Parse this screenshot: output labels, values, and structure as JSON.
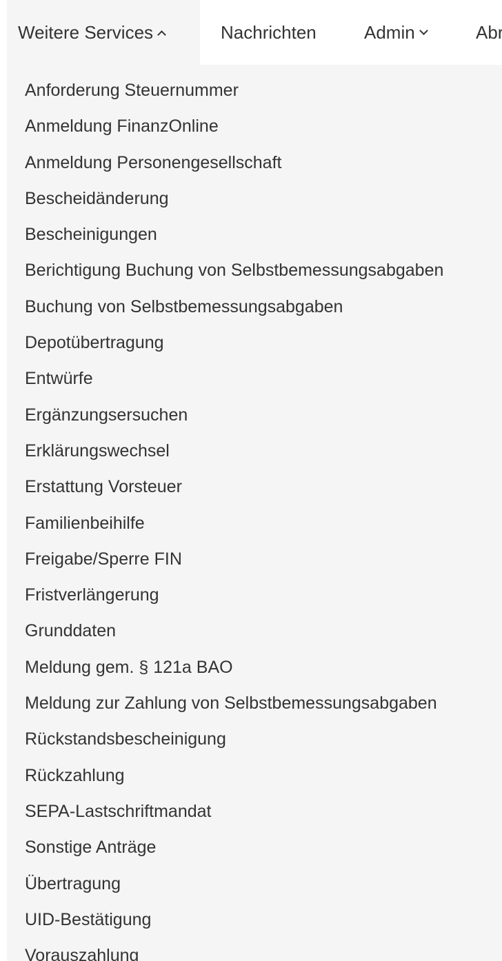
{
  "nav": {
    "items": [
      {
        "label": "Weitere Services"
      },
      {
        "label": "Nachrichten"
      },
      {
        "label": "Admin"
      },
      {
        "label": "Abr"
      }
    ]
  },
  "dropdown": {
    "items": [
      "Anforderung Steuernummer",
      "Anmeldung FinanzOnline",
      "Anmeldung Personengesellschaft",
      "Bescheidänderung",
      "Bescheinigungen",
      "Berichtigung Buchung von Selbstbemessungsabgaben",
      "Buchung von Selbstbemessungsabgaben",
      "Depotübertragung",
      "Entwürfe",
      "Ergänzungsersuchen",
      "Erklärungswechsel",
      "Erstattung Vorsteuer",
      "Familienbeihilfe",
      "Freigabe/Sperre FIN",
      "Fristverlängerung",
      "Grunddaten",
      "Meldung gem. § 121a BAO",
      "Meldung zur Zahlung von Selbstbemessungsabgaben",
      "Rückstandsbescheinigung",
      "Rückzahlung",
      "SEPA-Lastschriftmandat",
      "Sonstige Anträge",
      "Übertragung",
      "UID-Bestätigung",
      "Vorauszahlung"
    ]
  }
}
